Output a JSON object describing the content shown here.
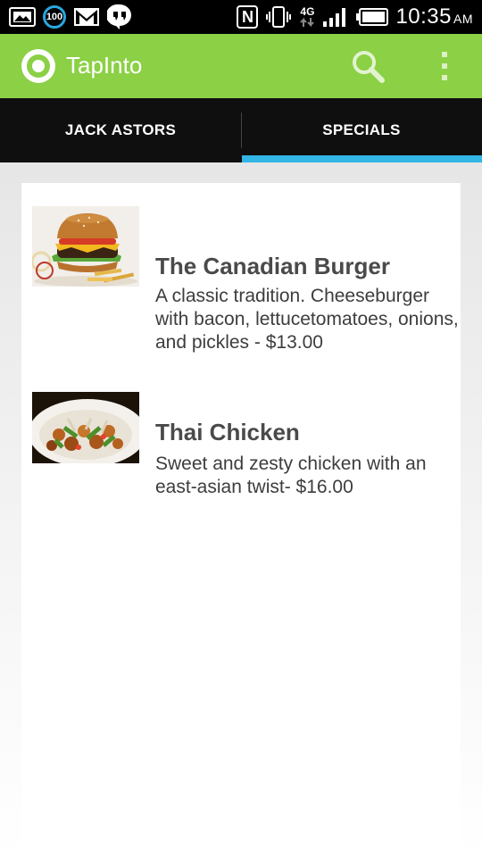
{
  "status_bar": {
    "battery_percent": "100",
    "network_label": "4G",
    "time": "10:35",
    "ampm": "AM",
    "icons": [
      "image-icon",
      "battery-percent-icon",
      "gmail-icon",
      "hangouts-icon",
      "nfc-icon",
      "vibrate-icon",
      "network-4g-icon",
      "signal-icon",
      "battery-icon"
    ]
  },
  "app_bar": {
    "title": "TapInto",
    "logo_icon": "tapinto-logo-icon",
    "search_icon": "search-icon",
    "overflow_icon": "overflow-menu-icon",
    "color": "#8bd045"
  },
  "tabs": [
    {
      "label": "JACK ASTORS",
      "selected": false
    },
    {
      "label": "SPECIALS",
      "selected": true
    }
  ],
  "accent_color": "#33b5e5",
  "specials": [
    {
      "title": "The Canadian Burger",
      "description": "A classic tradition. Cheeseburger with bacon, lettucetomatoes, onions, and pickles - $13.00",
      "image_icon": "burger-image"
    },
    {
      "title": "Thai Chicken",
      "description": "Sweet and zesty chicken with an east-asian twist- $16.00",
      "image_icon": "thai-chicken-image"
    }
  ]
}
